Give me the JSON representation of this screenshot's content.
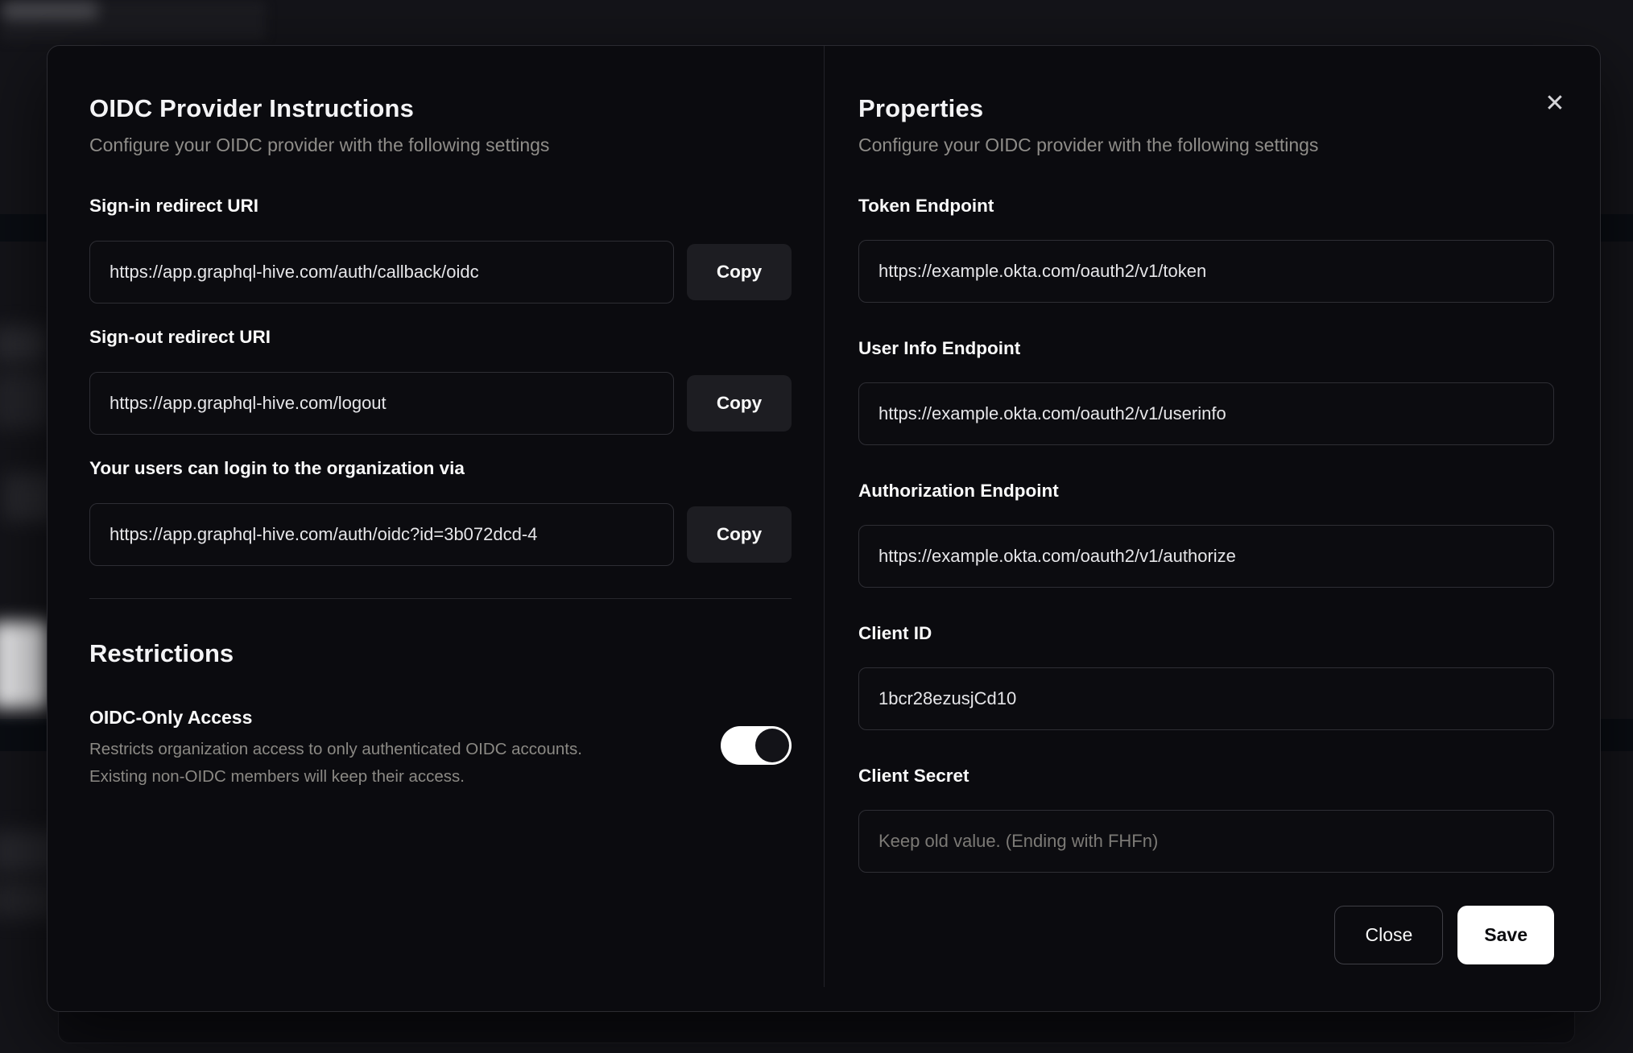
{
  "dialog": {
    "close_icon": "✕"
  },
  "left_panel": {
    "title": "OIDC Provider Instructions",
    "subtitle": "Configure your OIDC provider with the following settings",
    "fields": [
      {
        "label": "Sign-in redirect URI",
        "value": "https://app.graphql-hive.com/auth/callback/oidc",
        "copy_label": "Copy"
      },
      {
        "label": "Sign-out redirect URI",
        "value": "https://app.graphql-hive.com/logout",
        "copy_label": "Copy"
      },
      {
        "label": "Your users can login to the organization via",
        "value": "https://app.graphql-hive.com/auth/oidc?id=3b072dcd-4",
        "copy_label": "Copy"
      }
    ],
    "restrictions": {
      "heading": "Restrictions",
      "toggle_label": "OIDC-Only Access",
      "description_line1": "Restricts organization access to only authenticated OIDC accounts.",
      "description_line2": "Existing non-OIDC members will keep their access.",
      "toggle_state": "on"
    }
  },
  "right_panel": {
    "title": "Properties",
    "subtitle": "Configure your OIDC provider with the following settings",
    "fields": [
      {
        "label": "Token Endpoint",
        "value": "https://example.okta.com/oauth2/v1/token"
      },
      {
        "label": "User Info Endpoint",
        "value": "https://example.okta.com/oauth2/v1/userinfo"
      },
      {
        "label": "Authorization Endpoint",
        "value": "https://example.okta.com/oauth2/v1/authorize"
      },
      {
        "label": "Client ID",
        "value": "1bcr28ezusjCd10"
      },
      {
        "label": "Client Secret",
        "value": "",
        "placeholder": "Keep old value. (Ending with FHFn)"
      }
    ],
    "buttons": {
      "close": "Close",
      "save": "Save"
    }
  },
  "colors": {
    "backdrop": "#141419",
    "modal_background": "#0b0b0f",
    "modal_border": "#2b2b31",
    "input_border": "#2e2e34",
    "copy_button_background": "#1d1d22",
    "muted_text": "#8f8d89",
    "primary_text": "#fafafa",
    "save_button_background": "#ffffff",
    "toggle_track_on": "#ffffff",
    "toggle_thumb": "#131318"
  }
}
